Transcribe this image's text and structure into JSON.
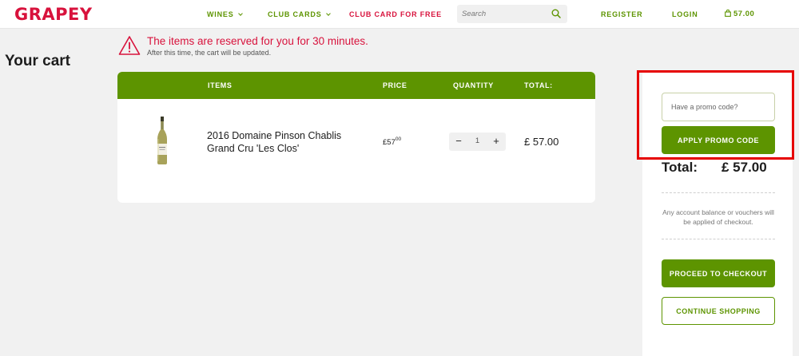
{
  "header": {
    "logo": "GRAPEY",
    "nav": {
      "wines": "WINES",
      "club_cards": "CLUB CARDS",
      "club_card_free": "CLUB CARD FOR FREE"
    },
    "search": {
      "placeholder": "Search"
    },
    "register": "REGISTER",
    "login": "LOGIN",
    "cart_total": "57.00"
  },
  "notice": {
    "main": "The items are reserved for you for 30 minutes.",
    "sub": "After this time, the cart will be updated."
  },
  "page_title": "Your cart",
  "cart": {
    "columns": {
      "items": "ITEMS",
      "price": "PRICE",
      "quantity": "QUANTITY",
      "total": "TOTAL:"
    },
    "rows": [
      {
        "name": "2016 Domaine Pinson Chablis Grand Cru 'Les Clos'",
        "price_main": "£57",
        "price_cents": "00",
        "quantity": "1",
        "total": "£ 57.00"
      }
    ]
  },
  "summary": {
    "promo_placeholder": "Have a promo code?",
    "apply_label": "APPLY PROMO CODE",
    "total_label": "Total:",
    "total_value": "£ 57.00",
    "balance_note": "Any account balance or vouchers will be applied of checkout.",
    "checkout_label": "PROCEED TO CHECKOUT",
    "continue_label": "CONTINUE SHOPPING"
  },
  "colors": {
    "brand_red": "#d8123c",
    "brand_green": "#5d9400",
    "highlight_red": "#e60000"
  }
}
